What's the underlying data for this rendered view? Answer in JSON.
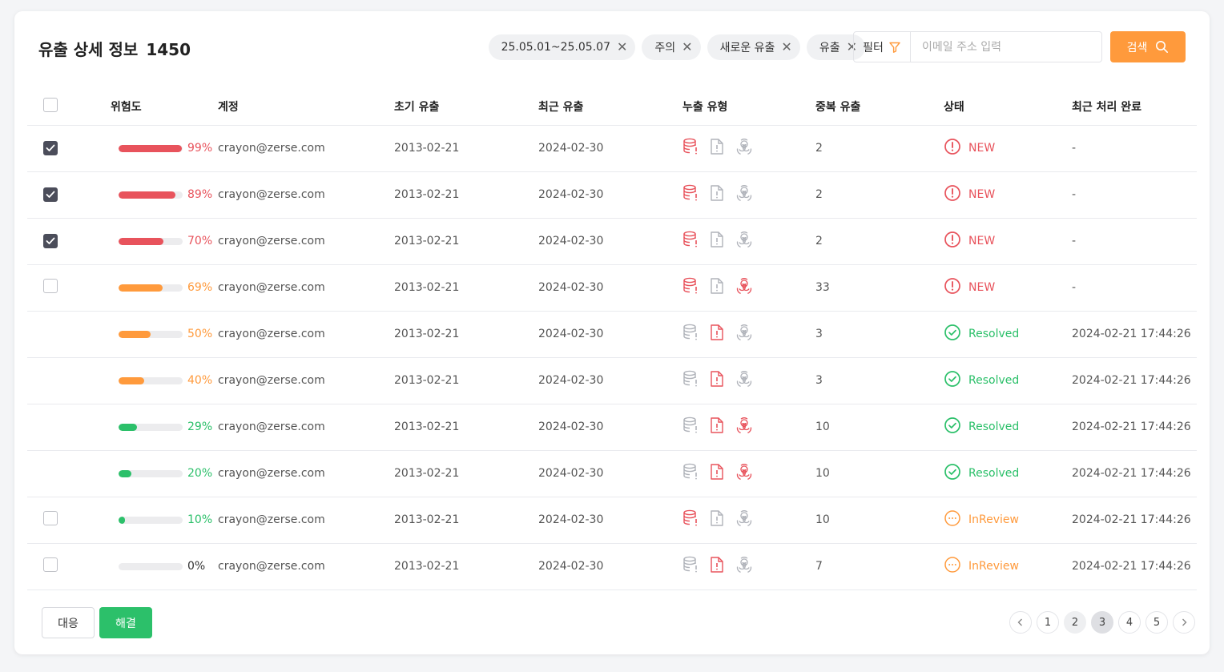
{
  "header": {
    "title": "유출 상세 정보",
    "count": "1450"
  },
  "chips": [
    {
      "label": "25.05.01~25.05.07"
    },
    {
      "label": "주의"
    },
    {
      "label": "새로운 유출"
    },
    {
      "label": "유출"
    }
  ],
  "filter": {
    "label": "필터",
    "placeholder": "이메일 주소 입력",
    "value": ""
  },
  "search": {
    "label": "검색"
  },
  "columns": [
    "위험도",
    "계정",
    "초기 유출",
    "최근 유출",
    "누출 유형",
    "중복 유출",
    "상태",
    "최근 처리 완료"
  ],
  "colors": {
    "red": "#e8535c",
    "orange": "#ff9a3c",
    "green": "#2cc06a",
    "gray": "#b0b3ba",
    "check": "#4b4d5a"
  },
  "rows": [
    {
      "checkbox": "checked",
      "risk": 99,
      "risk_label": "99%",
      "risk_color": "red",
      "account": "crayon@zerse.com",
      "first": "2013-02-21",
      "last": "2024-02-30",
      "types": {
        "db": true,
        "file": false,
        "bio": false
      },
      "dup": "2",
      "status": "NEW",
      "status_kind": "new",
      "completed": "-"
    },
    {
      "checkbox": "checked",
      "risk": 89,
      "risk_label": "89%",
      "risk_color": "red",
      "account": "crayon@zerse.com",
      "first": "2013-02-21",
      "last": "2024-02-30",
      "types": {
        "db": true,
        "file": false,
        "bio": false
      },
      "dup": "2",
      "status": "NEW",
      "status_kind": "new",
      "completed": "-"
    },
    {
      "checkbox": "checked",
      "risk": 70,
      "risk_label": "70%",
      "risk_color": "red",
      "account": "crayon@zerse.com",
      "first": "2013-02-21",
      "last": "2024-02-30",
      "types": {
        "db": true,
        "file": false,
        "bio": false
      },
      "dup": "2",
      "status": "NEW",
      "status_kind": "new",
      "completed": "-"
    },
    {
      "checkbox": "unchecked",
      "risk": 69,
      "risk_label": "69%",
      "risk_color": "orange",
      "account": "crayon@zerse.com",
      "first": "2013-02-21",
      "last": "2024-02-30",
      "types": {
        "db": true,
        "file": false,
        "bio": true
      },
      "dup": "33",
      "status": "NEW",
      "status_kind": "new",
      "completed": "-"
    },
    {
      "checkbox": "none",
      "risk": 50,
      "risk_label": "50%",
      "risk_color": "orange",
      "account": "crayon@zerse.com",
      "first": "2013-02-21",
      "last": "2024-02-30",
      "types": {
        "db": false,
        "file": true,
        "bio": false
      },
      "dup": "3",
      "status": "Resolved",
      "status_kind": "resolved",
      "completed": "2024-02-21 17:44:26"
    },
    {
      "checkbox": "none",
      "risk": 40,
      "risk_label": "40%",
      "risk_color": "orange",
      "account": "crayon@zerse.com",
      "first": "2013-02-21",
      "last": "2024-02-30",
      "types": {
        "db": false,
        "file": true,
        "bio": false
      },
      "dup": "3",
      "status": "Resolved",
      "status_kind": "resolved",
      "completed": "2024-02-21 17:44:26"
    },
    {
      "checkbox": "none",
      "risk": 29,
      "risk_label": "29%",
      "risk_color": "green",
      "account": "crayon@zerse.com",
      "first": "2013-02-21",
      "last": "2024-02-30",
      "types": {
        "db": false,
        "file": true,
        "bio": true
      },
      "dup": "10",
      "status": "Resolved",
      "status_kind": "resolved",
      "completed": "2024-02-21 17:44:26"
    },
    {
      "checkbox": "none",
      "risk": 20,
      "risk_label": "20%",
      "risk_color": "green",
      "account": "crayon@zerse.com",
      "first": "2013-02-21",
      "last": "2024-02-30",
      "types": {
        "db": false,
        "file": true,
        "bio": true
      },
      "dup": "10",
      "status": "Resolved",
      "status_kind": "resolved",
      "completed": "2024-02-21 17:44:26"
    },
    {
      "checkbox": "unchecked",
      "risk": 10,
      "risk_label": "10%",
      "risk_color": "green",
      "account": "crayon@zerse.com",
      "first": "2013-02-21",
      "last": "2024-02-30",
      "types": {
        "db": true,
        "file": false,
        "bio": false
      },
      "dup": "10",
      "status": "InReview",
      "status_kind": "review",
      "completed": "2024-02-21 17:44:26"
    },
    {
      "checkbox": "unchecked",
      "risk": 0,
      "risk_label": "0%",
      "risk_color": "dark",
      "account": "crayon@zerse.com",
      "first": "2013-02-21",
      "last": "2024-02-30",
      "types": {
        "db": false,
        "file": true,
        "bio": false
      },
      "dup": "7",
      "status": "InReview",
      "status_kind": "review",
      "completed": "2024-02-21 17:44:26"
    }
  ],
  "footer": {
    "respond_label": "대응",
    "resolve_label": "해결"
  },
  "pagination": {
    "pages": [
      "1",
      "2",
      "3",
      "4",
      "5"
    ],
    "current": "3"
  }
}
